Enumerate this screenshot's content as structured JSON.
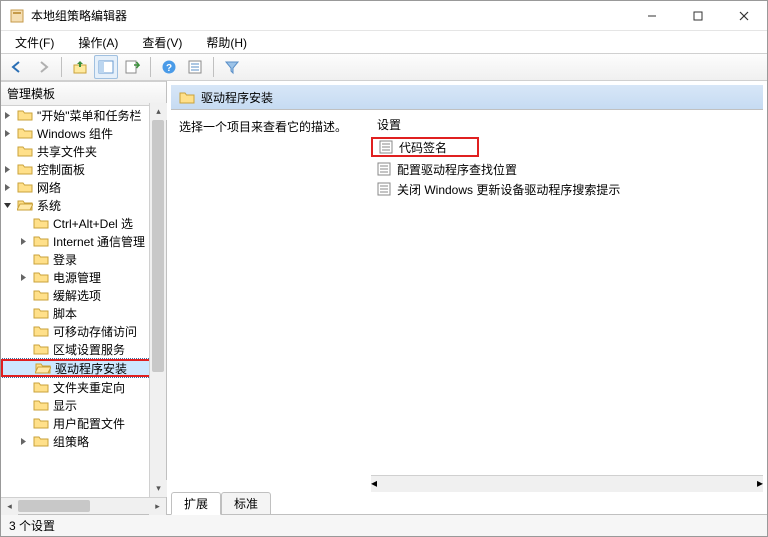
{
  "window": {
    "title": "本地组策略编辑器"
  },
  "menu": {
    "file": "文件(F)",
    "action": "操作(A)",
    "view": "查看(V)",
    "help": "帮助(H)"
  },
  "tree": {
    "header": "管理模板",
    "items": [
      {
        "depth": 1,
        "label": "\"开始\"菜单和任务栏",
        "expander": ">"
      },
      {
        "depth": 1,
        "label": "Windows 组件",
        "expander": ">"
      },
      {
        "depth": 1,
        "label": "共享文件夹",
        "expander": ""
      },
      {
        "depth": 1,
        "label": "控制面板",
        "expander": ">"
      },
      {
        "depth": 1,
        "label": "网络",
        "expander": ">"
      },
      {
        "depth": 1,
        "label": "系统",
        "expander": "v",
        "expanded": true
      },
      {
        "depth": 2,
        "label": "Ctrl+Alt+Del 选",
        "expander": ""
      },
      {
        "depth": 2,
        "label": "Internet 通信管理",
        "expander": ">"
      },
      {
        "depth": 2,
        "label": "登录",
        "expander": ""
      },
      {
        "depth": 2,
        "label": "电源管理",
        "expander": ">"
      },
      {
        "depth": 2,
        "label": "缓解选项",
        "expander": ""
      },
      {
        "depth": 2,
        "label": "脚本",
        "expander": ""
      },
      {
        "depth": 2,
        "label": "可移动存储访问",
        "expander": ""
      },
      {
        "depth": 2,
        "label": "区域设置服务",
        "expander": ""
      },
      {
        "depth": 2,
        "label": "驱动程序安装",
        "expander": "",
        "selected": true,
        "highlighted": true
      },
      {
        "depth": 2,
        "label": "文件夹重定向",
        "expander": ""
      },
      {
        "depth": 2,
        "label": "显示",
        "expander": ""
      },
      {
        "depth": 2,
        "label": "用户配置文件",
        "expander": ""
      },
      {
        "depth": 2,
        "label": "组策略",
        "expander": ">"
      }
    ]
  },
  "right": {
    "header": "驱动程序安装",
    "desc": "选择一个项目来查看它的描述。",
    "column": "设置",
    "settings": [
      {
        "label": "代码签名",
        "highlighted": true
      },
      {
        "label": "配置驱动程序查找位置"
      },
      {
        "label": "关闭 Windows 更新设备驱动程序搜索提示"
      }
    ],
    "tabs": {
      "extended": "扩展",
      "standard": "标准"
    }
  },
  "status": {
    "text": "3 个设置"
  }
}
